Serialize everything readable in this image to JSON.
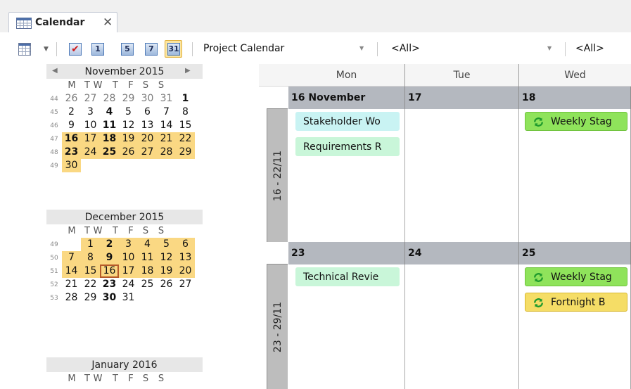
{
  "tab": {
    "label": "Calendar",
    "close": "✕",
    "icon": "calendar-icon"
  },
  "toolbar": {
    "view_buttons": [
      {
        "name": "todo-view-button",
        "text": ""
      },
      {
        "name": "day-view-button",
        "text": "1"
      },
      {
        "name": "workweek-view-button",
        "text": "5"
      },
      {
        "name": "week-view-button",
        "text": "7"
      },
      {
        "name": "month-view-button",
        "text": "31",
        "active": true
      }
    ],
    "calendar_select": "Project Calendar",
    "filter1": "<All>",
    "filter2": "<All>"
  },
  "minicals": [
    {
      "title": "November 2015",
      "dow": [
        "M",
        "T",
        "W",
        "T",
        "F",
        "S",
        "S"
      ],
      "weeks": [
        {
          "wk": "44",
          "days": [
            "26",
            "27",
            "28",
            "29",
            "30",
            "31",
            "1"
          ]
        },
        {
          "wk": "45",
          "days": [
            "2",
            "3",
            "4",
            "5",
            "6",
            "7",
            "8"
          ]
        },
        {
          "wk": "46",
          "days": [
            "9",
            "10",
            "11",
            "12",
            "13",
            "14",
            "15"
          ]
        },
        {
          "wk": "47",
          "days": [
            "16",
            "17",
            "18",
            "19",
            "20",
            "21",
            "22"
          ]
        },
        {
          "wk": "48",
          "days": [
            "23",
            "24",
            "25",
            "26",
            "27",
            "28",
            "29"
          ]
        },
        {
          "wk": "49",
          "days": [
            "30",
            "",
            "",
            "",
            "",
            "",
            ""
          ]
        }
      ]
    },
    {
      "title": "December 2015",
      "dow": [
        "M",
        "T",
        "W",
        "T",
        "F",
        "S",
        "S"
      ],
      "weeks": [
        {
          "wk": "49",
          "days": [
            "",
            "1",
            "2",
            "3",
            "4",
            "5",
            "6"
          ]
        },
        {
          "wk": "50",
          "days": [
            "7",
            "8",
            "9",
            "10",
            "11",
            "12",
            "13"
          ]
        },
        {
          "wk": "51",
          "days": [
            "14",
            "15",
            "16",
            "17",
            "18",
            "19",
            "20"
          ]
        },
        {
          "wk": "52",
          "days": [
            "21",
            "22",
            "23",
            "24",
            "25",
            "26",
            "27"
          ]
        },
        {
          "wk": "53",
          "days": [
            "28",
            "29",
            "30",
            "31",
            "",
            "",
            ""
          ]
        }
      ]
    },
    {
      "title": "January 2016",
      "dow": [
        "M",
        "T",
        "W",
        "T",
        "F",
        "S",
        "S"
      ],
      "weeks": []
    }
  ],
  "main": {
    "day_headers": [
      "Mon",
      "Tue",
      "Wed"
    ],
    "weeks": [
      {
        "label": "16 - 22/11",
        "dates": [
          "16 November",
          "17",
          "18"
        ],
        "appointments": [
          {
            "day": 0,
            "text": "Stakeholder Wo",
            "style": "cyan",
            "recurring": false
          },
          {
            "day": 0,
            "text": "Requirements R",
            "style": "mint",
            "recurring": false
          },
          {
            "day": 2,
            "text": "Weekly Stag",
            "style": "green",
            "recurring": true
          }
        ]
      },
      {
        "label": "23 - 29/11",
        "dates": [
          "23",
          "24",
          "25"
        ],
        "appointments": [
          {
            "day": 0,
            "text": "Technical Revie",
            "style": "mint",
            "recurring": false
          },
          {
            "day": 2,
            "text": "Weekly Stag",
            "style": "green",
            "recurring": true
          },
          {
            "day": 2,
            "text": "Fortnight B",
            "style": "yellow",
            "recurring": true
          }
        ]
      }
    ]
  }
}
